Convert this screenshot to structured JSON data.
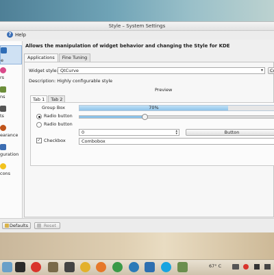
{
  "window": {
    "title": "Style – System Settings"
  },
  "menu": {
    "help_label": "Help",
    "help_icon": "help-icon"
  },
  "sidebar": {
    "items": [
      {
        "label": "e",
        "icon": "style-icon",
        "color": "#2f6db6",
        "active": true
      },
      {
        "label": "rs",
        "icon": "colors-icon",
        "color": "#d94a8a"
      },
      {
        "label": "ns",
        "icon": "icons-icon",
        "color": "#6c8e3a"
      },
      {
        "label": "ts",
        "icon": "fonts-icon",
        "color": "#555555"
      },
      {
        "label": "earance",
        "icon": "appearance-icon",
        "color": "#c0541a"
      },
      {
        "label": "guration",
        "icon": "configuration-icon",
        "color": "#3c6db2"
      },
      {
        "label": "cons",
        "icon": "emoticons-icon",
        "color": "#f2c21d"
      }
    ]
  },
  "content": {
    "heading": "Allows the manipulation of widget behavior and changing the Style for KDE",
    "tabs": [
      "Applications",
      "Fine Tuning"
    ],
    "widget_style_label": "Widget style:",
    "widget_style_value": "QtCurve",
    "configure_label": "Co",
    "description_label": "Description: Highly configurable style",
    "preview_title": "Preview",
    "preview_tabs": [
      "Tab 1",
      "Tab 2"
    ],
    "group_box_label": "Group Box",
    "progress_text": "70%",
    "progress_value": 0.7,
    "radio1_label": "Radio button",
    "radio2_label": "Radio button",
    "slider_value": 0.33,
    "spin_value": "0",
    "button_label": "Button",
    "checkbox_label": "Checkbox",
    "checkbox_checked": true,
    "combobox_label": "Combobox"
  },
  "bottom": {
    "defaults_label": "Defaults",
    "reset_label": "Reset"
  },
  "taskbar": {
    "icons": [
      {
        "name": "file-manager-icon",
        "color": "#6aa0c8"
      },
      {
        "name": "terminal-icon",
        "color": "#2b2b2b"
      },
      {
        "name": "power-icon",
        "color": "#d9342b"
      },
      {
        "name": "deb-installer-icon",
        "color": "#7a6a4a"
      },
      {
        "name": "apps-icon",
        "color": "#444444"
      },
      {
        "name": "banana-icon",
        "color": "#e3b12c"
      },
      {
        "name": "firefox-icon",
        "color": "#e6782a"
      },
      {
        "name": "chrome-icon",
        "color": "#3a9a48"
      },
      {
        "name": "network-icon",
        "color": "#2b7ab8"
      },
      {
        "name": "system-icon",
        "color": "#2e6fb0"
      },
      {
        "name": "skype-icon",
        "color": "#18a4e0"
      },
      {
        "name": "pictures-icon",
        "color": "#6b8e4e"
      }
    ],
    "temperature": "67° C"
  }
}
